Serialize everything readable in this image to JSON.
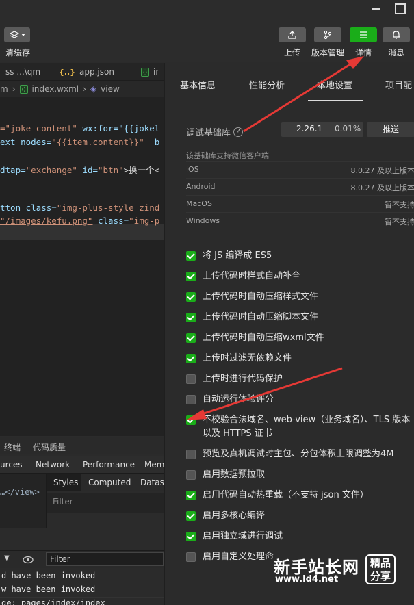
{
  "toolbar": {
    "clear_cache_label": "清缓存",
    "upload_label": "上传",
    "version_label": "版本管理",
    "details_label": "详情",
    "messages_label": "消息"
  },
  "editor_tabs": [
    {
      "label": "ss ...\\qm"
    },
    {
      "label": "app.json",
      "badge": "{..}"
    },
    {
      "label": "ir"
    }
  ],
  "breadcrumb": {
    "part1": "m",
    "file": "index.wxml",
    "part3": "view"
  },
  "code_lines": {
    "l1_attr": "=\"joke-content\"",
    "l1_rest": " wx:for=\"{{jokel",
    "l2_a": "ext nodes=",
    "l2_b": "\"{{item.content}}\"",
    "l2_c": "  b",
    "l3_a": "dtap=",
    "l3_b": "\"exchange\"",
    "l3_c": " id=",
    "l3_d": "\"btn\"",
    "l3_e": ">换一个<",
    "l4_a": "tton class=",
    "l4_b": "\"img-plus-style zind",
    "l5_a": "\"/images/kefu.png\"",
    "l5_b": " class=",
    "l5_c": "\"img-p"
  },
  "devtools": {
    "bar1": [
      "终端",
      "代码质量"
    ],
    "bar2": [
      "urces",
      "Network",
      "Performance",
      "Mem"
    ],
    "elements_snippet": "…</view>",
    "styles_tabs": [
      "Styles",
      "Computed",
      "Datase"
    ],
    "filter_placeholder": "Filter",
    "console_filter": "Filter",
    "console_lines": [
      "d have been invoked",
      "w have been invoked",
      "ge: pages/index/index"
    ]
  },
  "right_tabs": [
    "基本信息",
    "性能分析",
    "本地设置",
    "项目配"
  ],
  "sdk": {
    "label": "调试基础库",
    "version": "2.26.1",
    "percent": "0.01%",
    "push_label": "推送",
    "support_title": "该基础库支持微信客户端",
    "os": [
      {
        "name": "iOS",
        "value": "8.0.27 及以上版本"
      },
      {
        "name": "Android",
        "value": "8.0.27 及以上版本"
      },
      {
        "name": "MacOS",
        "value": "暂不支持"
      },
      {
        "name": "Windows",
        "value": "暂不支持"
      }
    ]
  },
  "settings": [
    {
      "label": "将 JS 编译成 ES5",
      "checked": true
    },
    {
      "label": "上传代码时样式自动补全",
      "checked": true
    },
    {
      "label": "上传代码时自动压缩样式文件",
      "checked": true
    },
    {
      "label": "上传代码时自动压缩脚本文件",
      "checked": true
    },
    {
      "label": "上传代码时自动压缩wxml文件",
      "checked": true
    },
    {
      "label": "上传时过滤无依赖文件",
      "checked": true
    },
    {
      "label": "上传时进行代码保护",
      "checked": false
    },
    {
      "label": "自动运行体验评分",
      "checked": false
    },
    {
      "label": "不校验合法域名、web-view（业务域名）、TLS 版本以及 HTTPS 证书",
      "checked": true
    },
    {
      "label": "预览及真机调试时主包、分包体积上限调整为4M",
      "checked": false
    },
    {
      "label": "启用数据预拉取",
      "checked": false
    },
    {
      "label": "启用代码自动热重载（不支持 json 文件）",
      "checked": true
    },
    {
      "label": "启用多核心编译",
      "checked": true
    },
    {
      "label": "启用独立域进行调试",
      "checked": true
    },
    {
      "label": "启用自定义处理命",
      "checked": false
    }
  ],
  "watermark": {
    "name": "新手站长网",
    "url": "www.ld4.net",
    "badge_line1": "精品",
    "badge_line2": "分享"
  },
  "colors": {
    "accent_green": "#1aad19",
    "arrow_red": "#e53935"
  }
}
